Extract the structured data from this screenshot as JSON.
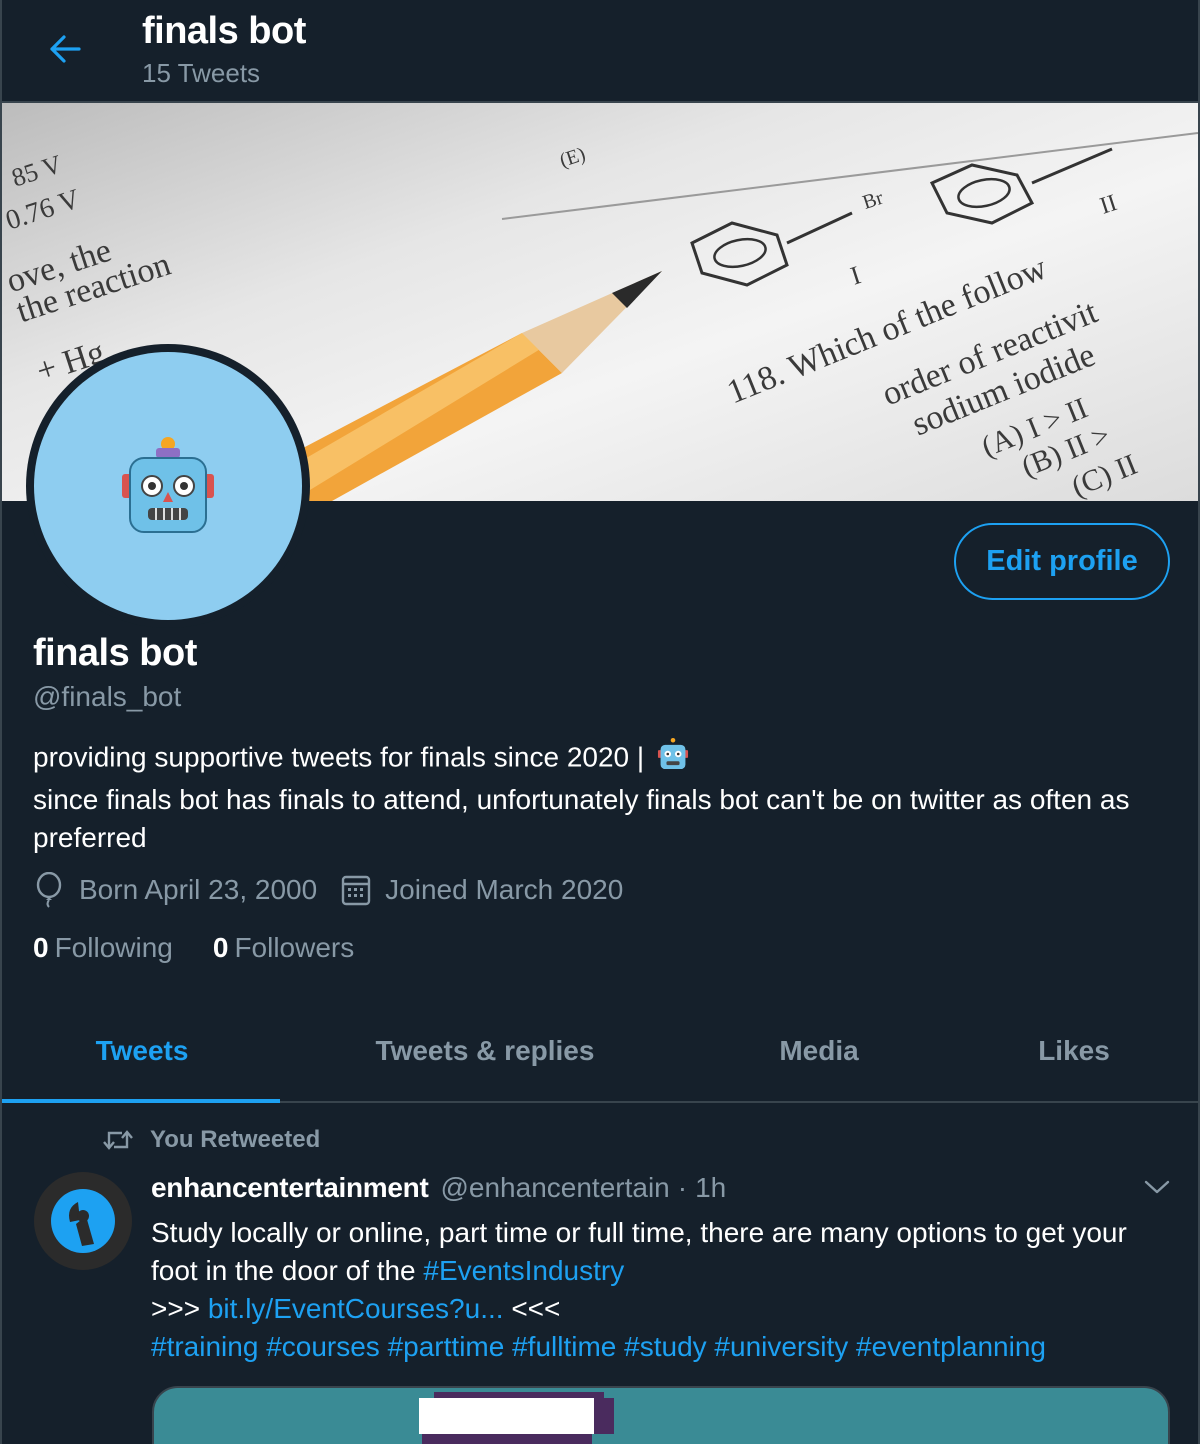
{
  "header": {
    "title": "finals bot",
    "tweet_count": "15 Tweets"
  },
  "banner": {
    "lines": [
      "85 V",
      "0.76 V",
      "ove, the",
      "the reaction",
      "+ Hg",
      "118. Which of the follow",
      "order of reactivit",
      "sodium iodide",
      "(A) I > II",
      "(B) II >",
      "(C) II",
      "Br",
      "I",
      "II",
      "(E)"
    ]
  },
  "profile": {
    "name": "finals bot",
    "handle": "@finals_bot",
    "edit_label": "Edit profile",
    "bio_line1": "providing supportive tweets for finals since 2020 |",
    "bio_line2": "since finals bot has finals to attend, unfortunately finals bot can't be on twitter as often as preferred",
    "born": "Born April 23, 2000",
    "joined": "Joined March 2020",
    "following_count": "0",
    "following_label": "Following",
    "followers_count": "0",
    "followers_label": "Followers"
  },
  "tabs": [
    "Tweets",
    "Tweets & replies",
    "Media",
    "Likes"
  ],
  "tweet": {
    "retweet_label": "You Retweeted",
    "author": "enhancentertainment",
    "handle": "@enhancentertain",
    "dot": "·",
    "time": "1h",
    "text1": "Study locally or online, part time or full time, there are many options to get your foot in the door of the ",
    "hashtag_events": "#EventsIndustry",
    "arrows_open": ">>> ",
    "url": "bit.ly/EventCourses?u...",
    "arrows_close": " <<<",
    "hashtags": [
      "#training",
      "#courses",
      "#parttime",
      "#fulltime",
      "#study",
      "#university",
      "#eventplanning"
    ]
  },
  "colors": {
    "background": "#15202b",
    "accent": "#1da1f2",
    "muted": "#8899a6",
    "border": "#38444d",
    "avatar_bg": "#8ecdf0"
  },
  "icons": [
    "back-arrow-icon",
    "robot-face-icon",
    "balloon-icon",
    "calendar-icon",
    "retweet-icon",
    "chevron-down-icon"
  ]
}
